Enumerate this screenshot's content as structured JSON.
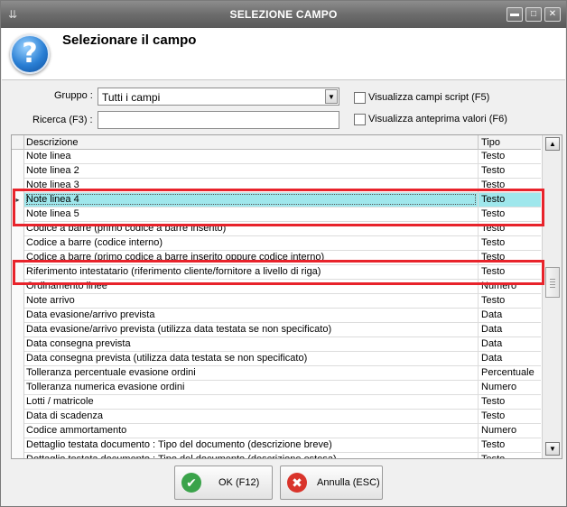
{
  "window": {
    "title": "SELEZIONE CAMPO",
    "header_title": "Selezionare il campo"
  },
  "form": {
    "gruppo_label": "Gruppo :",
    "gruppo_value": "Tutti i campi",
    "ricerca_label": "Ricerca (F3) :",
    "ricerca_value": "",
    "chk_script_label": "Visualizza campi script (F5)",
    "chk_anteprima_label": "Visualizza anteprima valori (F6)"
  },
  "grid": {
    "col_descrizione": "Descrizione",
    "col_tipo": "Tipo",
    "rows": [
      {
        "desc": "Note linea",
        "tipo": "Testo"
      },
      {
        "desc": "Note linea 2",
        "tipo": "Testo"
      },
      {
        "desc": "Note linea 3",
        "tipo": "Testo"
      },
      {
        "desc": "Note linea 4",
        "tipo": "Testo"
      },
      {
        "desc": "Note linea 5",
        "tipo": "Testo"
      },
      {
        "desc": "Codice a barre (primo codice a barre inserito)",
        "tipo": "Testo"
      },
      {
        "desc": "Codice a barre (codice interno)",
        "tipo": "Testo"
      },
      {
        "desc": "Codice a barre (primo codice a barre inserito oppure codice interno)",
        "tipo": "Testo"
      },
      {
        "desc": "Riferimento intestatario (riferimento cliente/fornitore a livello di riga)",
        "tipo": "Testo"
      },
      {
        "desc": "Ordinamento linee",
        "tipo": "Numero"
      },
      {
        "desc": "Note arrivo",
        "tipo": "Testo"
      },
      {
        "desc": "Data evasione/arrivo prevista",
        "tipo": "Data"
      },
      {
        "desc": "Data evasione/arrivo prevista (utilizza data testata se non specificato)",
        "tipo": "Data"
      },
      {
        "desc": "Data consegna prevista",
        "tipo": "Data"
      },
      {
        "desc": "Data consegna prevista (utilizza data testata se non specificato)",
        "tipo": "Data"
      },
      {
        "desc": "Tolleranza percentuale evasione ordini",
        "tipo": "Percentuale"
      },
      {
        "desc": "Tolleranza numerica evasione ordini",
        "tipo": "Numero"
      },
      {
        "desc": "Lotti / matricole",
        "tipo": "Testo"
      },
      {
        "desc": "Data di scadenza",
        "tipo": "Testo"
      },
      {
        "desc": "Codice ammortamento",
        "tipo": "Numero"
      },
      {
        "desc": "Dettaglio testata documento : Tipo del documento (descrizione breve)",
        "tipo": "Testo"
      },
      {
        "desc": "Dettaglio testata documento : Tipo del documento (descrizione estesa)",
        "tipo": "Testo"
      }
    ]
  },
  "buttons": {
    "ok_label": "OK (F12)",
    "annulla_label": "Annulla (ESC)"
  },
  "colors": {
    "selection": "#9fe7ec",
    "highlight": "#e8232b",
    "ok_icon": "#3aa34a",
    "cancel_icon": "#d9342b"
  }
}
